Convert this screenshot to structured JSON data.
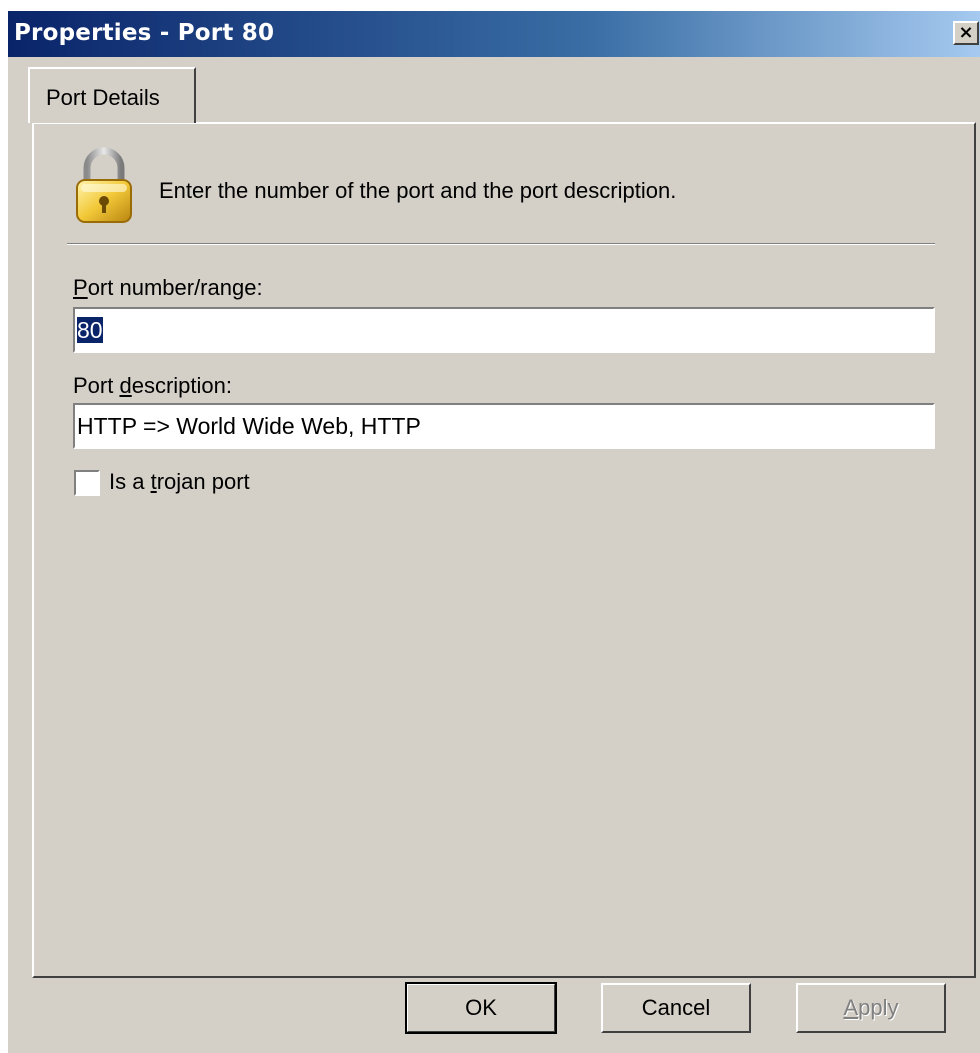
{
  "window": {
    "title": "Properties - Port 80",
    "close_glyph": "×",
    "close_icon": "close-icon"
  },
  "tabs": [
    {
      "label": "Port Details",
      "active": true
    }
  ],
  "header": {
    "icon": "lock-icon",
    "text": "Enter the number of the port and the port description."
  },
  "port_number": {
    "label_mnemonic": "P",
    "label_rest": "ort number/range:",
    "value": "80"
  },
  "port_description": {
    "label_before": "Port ",
    "label_mnemonic": "d",
    "label_after": "escription:",
    "value": "HTTP => World Wide Web, HTTP"
  },
  "trojan": {
    "checked": false,
    "label_before": "Is a ",
    "label_mnemonic": "t",
    "label_after": "rojan port"
  },
  "buttons": {
    "ok": "OK",
    "cancel": "Cancel",
    "apply_mnemonic": "A",
    "apply_rest": "pply",
    "apply_enabled": false
  },
  "colors": {
    "titlebar_start": "#0a246a",
    "titlebar_end": "#a6caf0",
    "face": "#d4d0c8",
    "selection": "#0a246a"
  }
}
